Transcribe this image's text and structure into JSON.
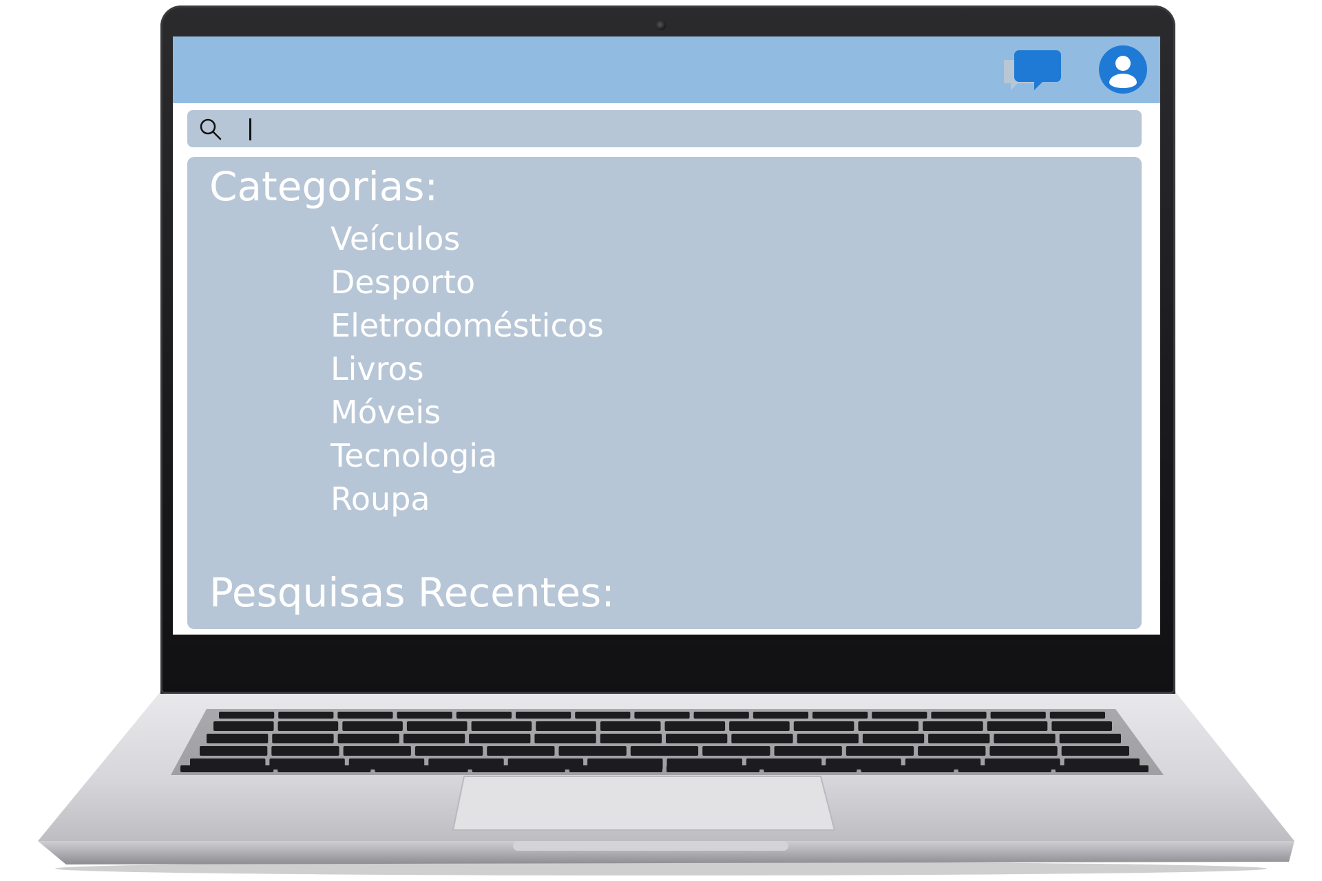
{
  "device": "laptop",
  "header": {
    "icons": [
      "chat-icon",
      "profile-icon"
    ],
    "bar_color": "#91bbe0",
    "icon_color": "#1f7ad6"
  },
  "search": {
    "icon": "search-icon",
    "value": ""
  },
  "categories": {
    "heading": "Categorias:",
    "items": [
      {
        "label": "Veículos"
      },
      {
        "label": "Desporto"
      },
      {
        "label": "Eletrodomésticos"
      },
      {
        "label": "Livros"
      },
      {
        "label": "Móveis"
      },
      {
        "label": "Tecnologia"
      },
      {
        "label": "Roupa"
      }
    ]
  },
  "recent_searches": {
    "heading": "Pesquisas Recentes:"
  },
  "colors": {
    "panel": "#b7c6d6",
    "text": "#ffffff",
    "accent": "#1f7ad6"
  }
}
